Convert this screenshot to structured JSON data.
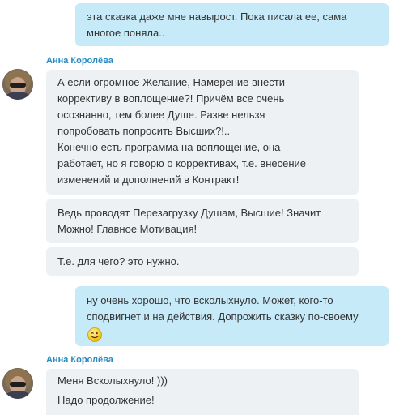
{
  "messages": [
    {
      "direction": "outgoing",
      "lines": [
        "эта сказка даже мне навырост. Пока писала ее, сама",
        "многое поняла.."
      ]
    },
    {
      "direction": "incoming",
      "sender": "Анна Королёва",
      "bubbles": [
        {
          "lines": [
            "А если огромное Желание, Намерение внести",
            "коррективу в воплощение?! Причём все очень",
            "осознанно, тем более Душе. Разве нельзя",
            "попробовать попросить Высших?!..",
            "Конечно есть программа на воплощение, она",
            "работает, но я говорю о коррективах, т.е. внесение",
            "изменений и дополнений в Контракт!"
          ]
        },
        {
          "lines": [
            "Ведь проводят Перезагрузку Душам, Высшие! Значит",
            "Можно! Главное Мотивация!"
          ]
        },
        {
          "lines": [
            "Т.е. для чего? это нужно."
          ]
        }
      ]
    },
    {
      "direction": "outgoing",
      "lines": [
        "ну очень хорошо, что всколыхнуло. Может, кого-то",
        "сподвигнет и на действия. Допрожить сказку по-своему"
      ],
      "emoticon": "wink-smiley-icon"
    },
    {
      "direction": "incoming",
      "sender": "Анна Королёва",
      "bubbles": [
        {
          "lines": [
            "Меня Всколыхнуло! )))",
            "Надо продолжение!"
          ]
        }
      ]
    }
  ],
  "colors": {
    "outgoing_bubble": "#c6eaf8",
    "incoming_bubble": "#eef1f4",
    "sender_name": "#2a8bc1"
  }
}
